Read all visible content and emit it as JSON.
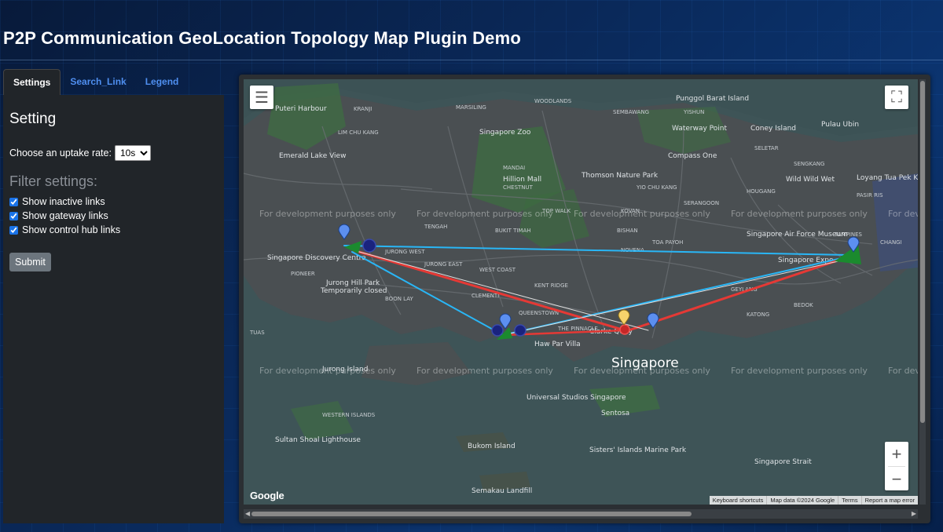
{
  "page": {
    "title": "P2P Communication GeoLocation Topology Map Plugin Demo"
  },
  "tabs": [
    {
      "label": "Settings",
      "active": true
    },
    {
      "label": "Search_Link",
      "active": false
    },
    {
      "label": "Legend",
      "active": false
    }
  ],
  "settings": {
    "heading": "Setting",
    "rate_label": "Choose an uptake rate:",
    "rate_value": "10s",
    "filter_heading": "Filter settings:",
    "filters": [
      {
        "label": "Show inactive links",
        "checked": true
      },
      {
        "label": "Show gateway links",
        "checked": true
      },
      {
        "label": "Show control hub links",
        "checked": true
      }
    ],
    "submit_label": "Submit"
  },
  "map": {
    "watermark": "For development purposes only",
    "logo": "Google",
    "attribution": {
      "shortcuts": "Keyboard shortcuts",
      "data": "Map data ©2024 Google",
      "terms": "Terms",
      "report": "Report a map error"
    },
    "zoom_in": "+",
    "zoom_out": "−",
    "labels": {
      "city": "Singapore",
      "poi": [
        "Punggol Barat Island",
        "Singapore Zoo",
        "Pulau Ubin",
        "Waterway Point",
        "Coney Island",
        "Hillion Mall",
        "Thomson Nature Park",
        "Compass One",
        "Emerald Lake View",
        "Wild Wild Wet",
        "Loyang Tua Pek Kong",
        "Singapore Discovery Centre",
        "Jurong Hill Park",
        "Temporarily closed",
        "Haw Par Villa",
        "Clarke Quay",
        "Universal Studios Singapore",
        "Sentosa",
        "Sultan Shoal Lighthouse",
        "Bukom Island",
        "Sisters' Islands Marine Park",
        "Semakau Landfill",
        "Singapore Air Force Museum",
        "Singapore Expo",
        "Puteri Harbour",
        "Jurong Island",
        "Singapore Strait"
      ],
      "districts": [
        "MARSILING",
        "WOODLANDS",
        "SEMBAWANG",
        "YISHUN",
        "SELETAR",
        "SENGKANG",
        "HOUGANG",
        "SERANGOON",
        "BUKIT TIMAH",
        "TENGAH",
        "JURONG WEST",
        "JURONG EAST",
        "CLEMENTI",
        "BOON LAY",
        "TUAS",
        "NOVENA",
        "BISHAN",
        "TOA PAYOH",
        "GEYLANG",
        "KATONG",
        "BEDOK",
        "TAMPINES",
        "PASIR RIS",
        "QUEENSTOWN",
        "MANDAI",
        "LIM CHU KANG",
        "KRANJI",
        "CHANGI",
        "YIO CHU KANG",
        "KOVAN",
        "THE PINNACLE",
        "CHESTNUT",
        "TOP WALK",
        "PIONEER",
        "WEST COAST",
        "WESTERN ISLANDS",
        "KENT RIDGE"
      ]
    },
    "colors": {
      "active_link": "#e53935",
      "inactive_link": "#29b6f6",
      "control_link": "#e0e0e0",
      "gateway_node": "#1a237e",
      "marker": "#5c8ff0",
      "hub_marker": "#f6d36b",
      "triangle": "#1b8a2e"
    }
  }
}
